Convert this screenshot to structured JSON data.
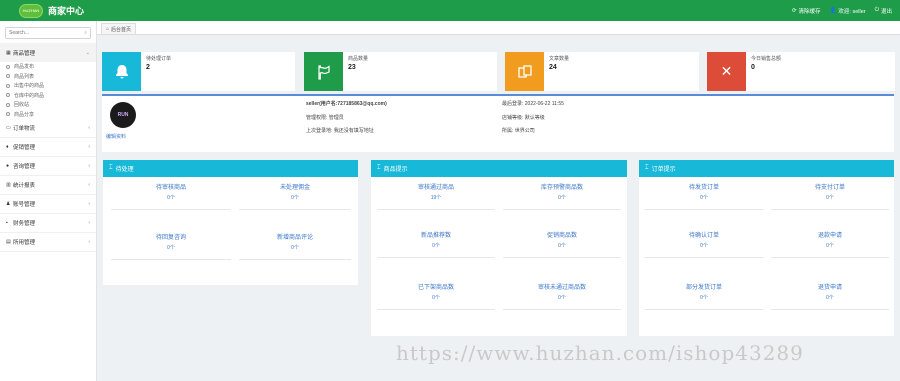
{
  "topbar": {
    "logo_text": "HUZHAN",
    "title": "商家中心",
    "clear_cache": "清除缓存",
    "welcome": "欢迎: seller",
    "logout": "退出"
  },
  "sidebar": {
    "search_placeholder": "Search...",
    "groups": [
      {
        "label": "商品管理",
        "icon": "grid-icon"
      },
      {
        "label": "订单物流",
        "icon": "card-icon"
      },
      {
        "label": "促销管理",
        "icon": "fire-icon"
      },
      {
        "label": "咨询管理",
        "icon": "chat-icon"
      },
      {
        "label": "统计报表",
        "icon": "chart-icon"
      },
      {
        "label": "账号管理",
        "icon": "user-icon"
      },
      {
        "label": "财务管理",
        "icon": "money-icon"
      },
      {
        "label": "所用管理",
        "icon": "doc-icon"
      }
    ],
    "sub_items": [
      "商品发布",
      "商品列表",
      "出售中的商品",
      "仓库中的商品",
      "回收站",
      "商品分享"
    ]
  },
  "tabs": [
    "后台首页"
  ],
  "stats": [
    {
      "label": "待处理订单",
      "value": "2",
      "color": "#18b8d9",
      "icon": "bell-icon"
    },
    {
      "label": "商品数量",
      "value": "23",
      "color": "#1e9c4a",
      "icon": "flag-icon"
    },
    {
      "label": "文章数量",
      "value": "24",
      "color": "#f29c1f",
      "icon": "copy-icon"
    },
    {
      "label": "今日销售总额",
      "value": "0",
      "color": "#dd4b39",
      "icon": "close-icon"
    }
  ],
  "info": {
    "avatar_text": "RUN",
    "edit_link": "编辑资料",
    "user": "seller(用户名:727185863@qq.com)",
    "role": "管理权限: 管理员",
    "location": "上次登录地: 我还没有填写地址",
    "last_login": "最后登录: 2022-06-22 11:55",
    "shop_type": "店铺等级: 默认等级",
    "bank": "所属: 世界公司"
  },
  "panels": [
    {
      "title": "待处理",
      "cells": [
        {
          "label": "待审核商品",
          "value": "0个"
        },
        {
          "label": "未处理佣金",
          "value": "0个"
        },
        {
          "label": "待回复咨询",
          "value": "0个"
        },
        {
          "label": "新增商品评论",
          "value": "0个"
        }
      ]
    },
    {
      "title": "商品提示",
      "cells": [
        {
          "label": "审核通过商品",
          "value": "19个"
        },
        {
          "label": "库存预警商品数",
          "value": "0个"
        },
        {
          "label": "新品推荐数",
          "value": "0个"
        },
        {
          "label": "促销商品数",
          "value": "0个"
        },
        {
          "label": "已下架商品数",
          "value": "0个"
        },
        {
          "label": "审核未通过商品数",
          "value": "0个"
        }
      ]
    },
    {
      "title": "订单提示",
      "cells": [
        {
          "label": "待发货订单",
          "value": "0个"
        },
        {
          "label": "待支付订单",
          "value": "0个"
        },
        {
          "label": "待确认订单",
          "value": "0个"
        },
        {
          "label": "退款申请",
          "value": "0个"
        },
        {
          "label": "部分发货订单",
          "value": "0个"
        },
        {
          "label": "退货申请",
          "value": "0个"
        }
      ]
    }
  ],
  "watermark": "https://www.huzhan.com/ishop43289"
}
